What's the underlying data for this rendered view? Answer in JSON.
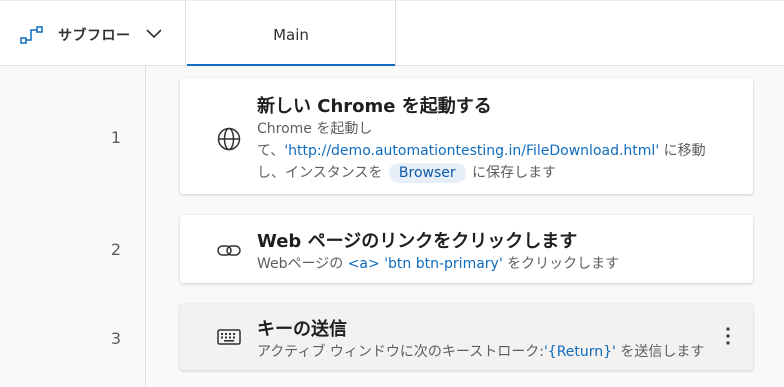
{
  "toolbar": {
    "subflow_label": "サブフロー",
    "tab_main_label": "Main"
  },
  "steps": [
    {
      "number": "1",
      "title": "新しい Chrome を起動する",
      "desc_1": "Chrome を起動して、",
      "url": "'http://demo.automationtesting.in/FileDownload.html'",
      "desc_2": " に移動し、インスタンスを ",
      "variable": "Browser",
      "desc_3": " に保存します"
    },
    {
      "number": "2",
      "title": "Web ページのリンクをクリックします",
      "desc_1": "Webページの ",
      "element": "<a> 'btn btn-primary'",
      "desc_2": " をクリックします"
    },
    {
      "number": "3",
      "title": "キーの送信",
      "desc_1": "アクティブ ウィンドウに次のキーストローク:",
      "keys": "'{Return}'",
      "desc_2": " を送信します"
    }
  ],
  "icons": {
    "subflow": "subflow-icon",
    "chevron": "chevron-down-icon",
    "step1": "globe-icon",
    "step2": "link-icon",
    "step3": "keyboard-icon",
    "more": "more-options-icon"
  },
  "colors": {
    "accent": "#0f6cbd",
    "link": "#0f6cbd",
    "variable_pill": "#e6eef8",
    "selected_card": "#f3f2f1"
  }
}
